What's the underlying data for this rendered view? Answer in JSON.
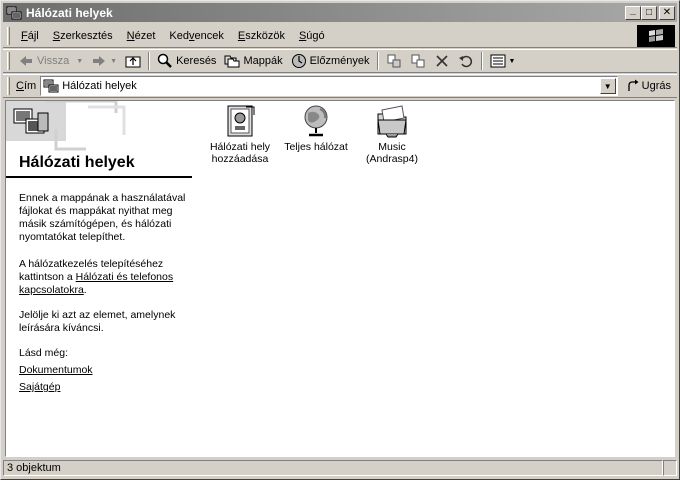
{
  "window": {
    "title": "Hálózati helyek",
    "minimize_glyph": "_",
    "maximize_glyph": "□",
    "close_glyph": "✕"
  },
  "menu": [
    {
      "pre": "",
      "key": "F",
      "post": "ájl"
    },
    {
      "pre": "",
      "key": "S",
      "post": "zerkesztés"
    },
    {
      "pre": "",
      "key": "N",
      "post": "ézet"
    },
    {
      "pre": "Ked",
      "key": "v",
      "post": "encek"
    },
    {
      "pre": "",
      "key": "E",
      "post": "szközök"
    },
    {
      "pre": "",
      "key": "S",
      "post": "úgó"
    }
  ],
  "toolbar": {
    "back_label": "Vissza",
    "search_label": "Keresés",
    "folders_label": "Mappák",
    "history_label": "Előzmények"
  },
  "address": {
    "label_key": "C",
    "label_rest": "ím",
    "value": "Hálózati helyek",
    "go_label": "Ugrás"
  },
  "left_pane": {
    "title": "Hálózati helyek",
    "paragraph1": "Ennek a mappának a használatával fájlokat és mappákat nyithat meg másik számítógépen, és hálózati nyomtatókat telepíthet.",
    "paragraph2_pre": "A hálózatkezelés telepítéséhez kattintson a ",
    "paragraph2_link": "Hálózati és telefonos kapcsolatokra",
    "paragraph2_post": ".",
    "paragraph3": "Jelölje ki azt az elemet, amelynek leírására kíváncsi.",
    "see_also": "Lásd még:",
    "link_documents": "Dokumentumok",
    "link_mycomputer": "Sajátgép"
  },
  "items": [
    {
      "icon": "add-network-place-icon",
      "line1": "Hálózati hely",
      "line2": "hozzáadása"
    },
    {
      "icon": "entire-network-globe-icon",
      "line1": "Teljes hálózat",
      "line2": ""
    },
    {
      "icon": "shared-folder-icon",
      "line1": "Music",
      "line2": "(Andrasp4)"
    }
  ],
  "status": {
    "text": "3 objektum"
  }
}
